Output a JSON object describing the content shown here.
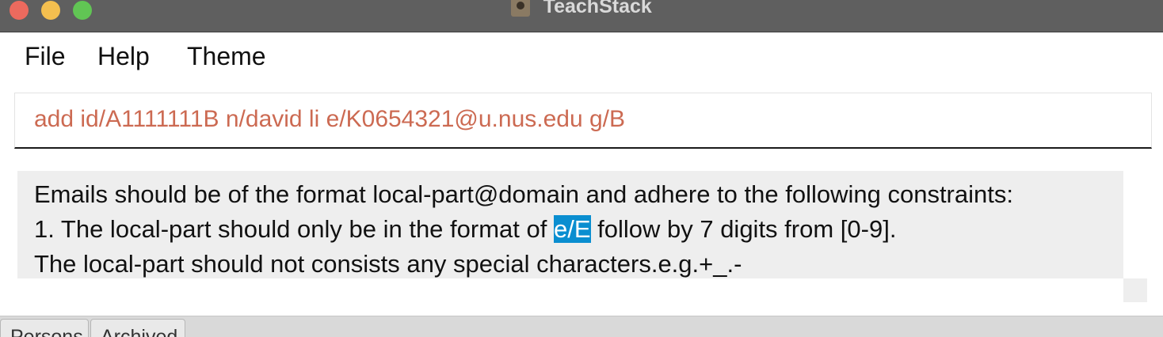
{
  "window": {
    "title": "TeachStack"
  },
  "menu": {
    "items": [
      "File",
      "Help",
      "Theme"
    ]
  },
  "command": {
    "value": "add id/A1111111B n/david li e/K0654321@u.nus.edu g/B"
  },
  "result": {
    "line1": "Emails should be of the format local-part@domain and adhere to the following constraints:",
    "line2_before": "1. The local-part should only be in the format of ",
    "line2_highlight": "e/E",
    "line2_after": " follow by 7 digits from [0-9].",
    "line3": "The local-part should not consists any special characters.e.g.+_.-"
  },
  "tabs": [
    "Persons",
    "Archived"
  ],
  "colors": {
    "titlebar": "#5f5f5f",
    "command_text": "#cc6a52",
    "highlight": "#0a8ed0",
    "result_bg": "#eeeeee"
  }
}
